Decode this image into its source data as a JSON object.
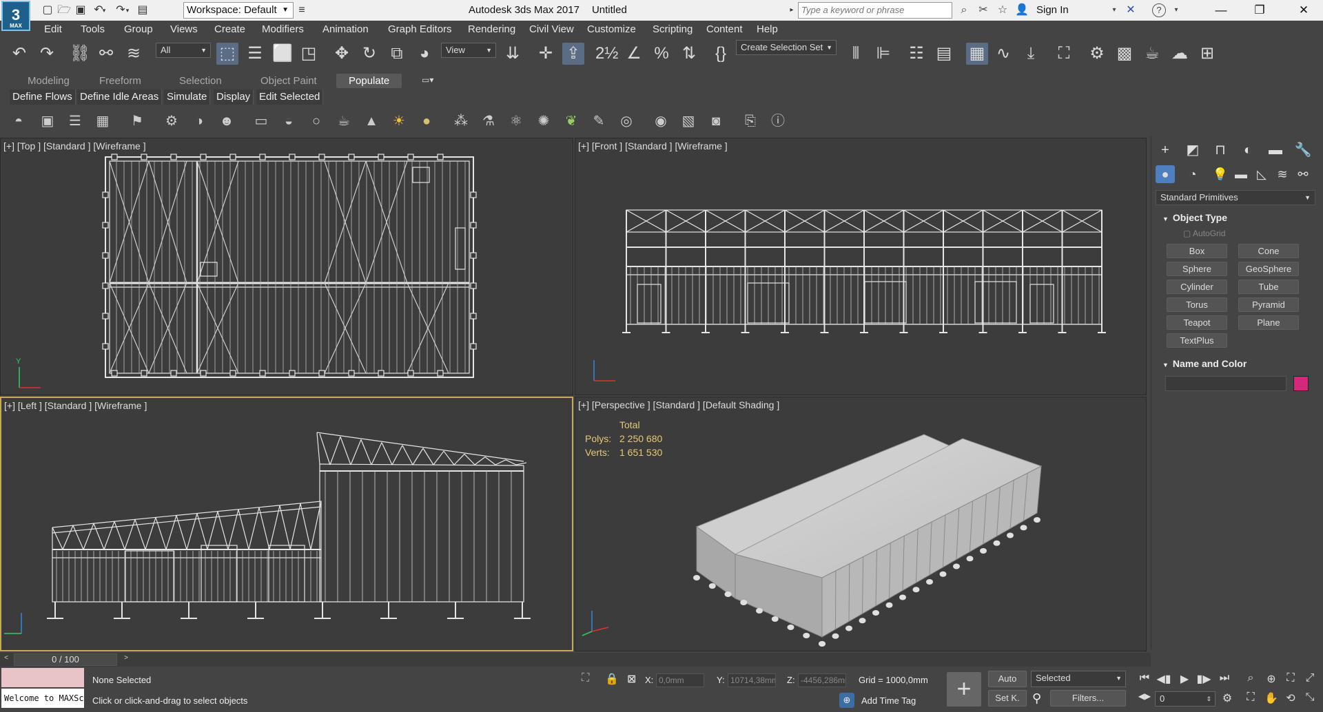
{
  "app": {
    "logo_number": "3",
    "logo_text": "MAX",
    "title": "Autodesk 3ds Max 2017",
    "document": "Untitled",
    "workspace": "Workspace: Default",
    "search_placeholder": "Type a keyword or phrase",
    "sign_in": "Sign In"
  },
  "menus": [
    "Edit",
    "Tools",
    "Group",
    "Views",
    "Create",
    "Modifiers",
    "Animation",
    "Graph Editors",
    "Rendering",
    "Civil View",
    "Customize",
    "Scripting",
    "Content",
    "Help"
  ],
  "toolbar": {
    "filter": "All",
    "ref_coord": "View",
    "selection_set": "Create Selection Set"
  },
  "ribbon": {
    "tabs": [
      "Modeling",
      "Freeform",
      "Selection",
      "Object Paint",
      "Populate"
    ],
    "active_tab": "Populate",
    "subtabs": [
      "Define Flows",
      "Define Idle Areas",
      "Simulate",
      "Display",
      "Edit Selected"
    ]
  },
  "viewports": {
    "top": "[+] [Top ] [Standard ] [Wireframe ]",
    "front": "[+] [Front ] [Standard ] [Wireframe ]",
    "left": "[+] [Left ] [Standard ] [Wireframe ]",
    "perspective": "[+] [Perspective ] [Standard ] [Default Shading ]"
  },
  "stats": {
    "header": "Total",
    "polys_label": "Polys:",
    "polys": "2 250 680",
    "verts_label": "Verts:",
    "verts": "1 651 530"
  },
  "command_panel": {
    "category": "Standard Primitives",
    "object_type_title": "Object Type",
    "autogrid": "AutoGrid",
    "buttons": [
      "Box",
      "Cone",
      "Sphere",
      "GeoSphere",
      "Cylinder",
      "Tube",
      "Torus",
      "Pyramid",
      "Teapot",
      "Plane",
      "TextPlus"
    ],
    "name_color_title": "Name and Color",
    "object_color": "#d6287a"
  },
  "timeline": {
    "frame": "0 / 100"
  },
  "status": {
    "maxscript": "Welcome to MAXScript.",
    "selection": "None Selected",
    "prompt": "Click or click-and-drag to select objects",
    "x_label": "X:",
    "x": "0,0mm",
    "y_label": "Y:",
    "y": "10714,38mm",
    "z_label": "Z:",
    "z": "-4456,286mm",
    "grid": "Grid = 1000,0mm",
    "add_time_tag": "Add Time Tag",
    "auto": "Auto",
    "set_key": "Set K.",
    "key_mode": "Selected",
    "filters": "Filters...",
    "current_frame": "0"
  }
}
